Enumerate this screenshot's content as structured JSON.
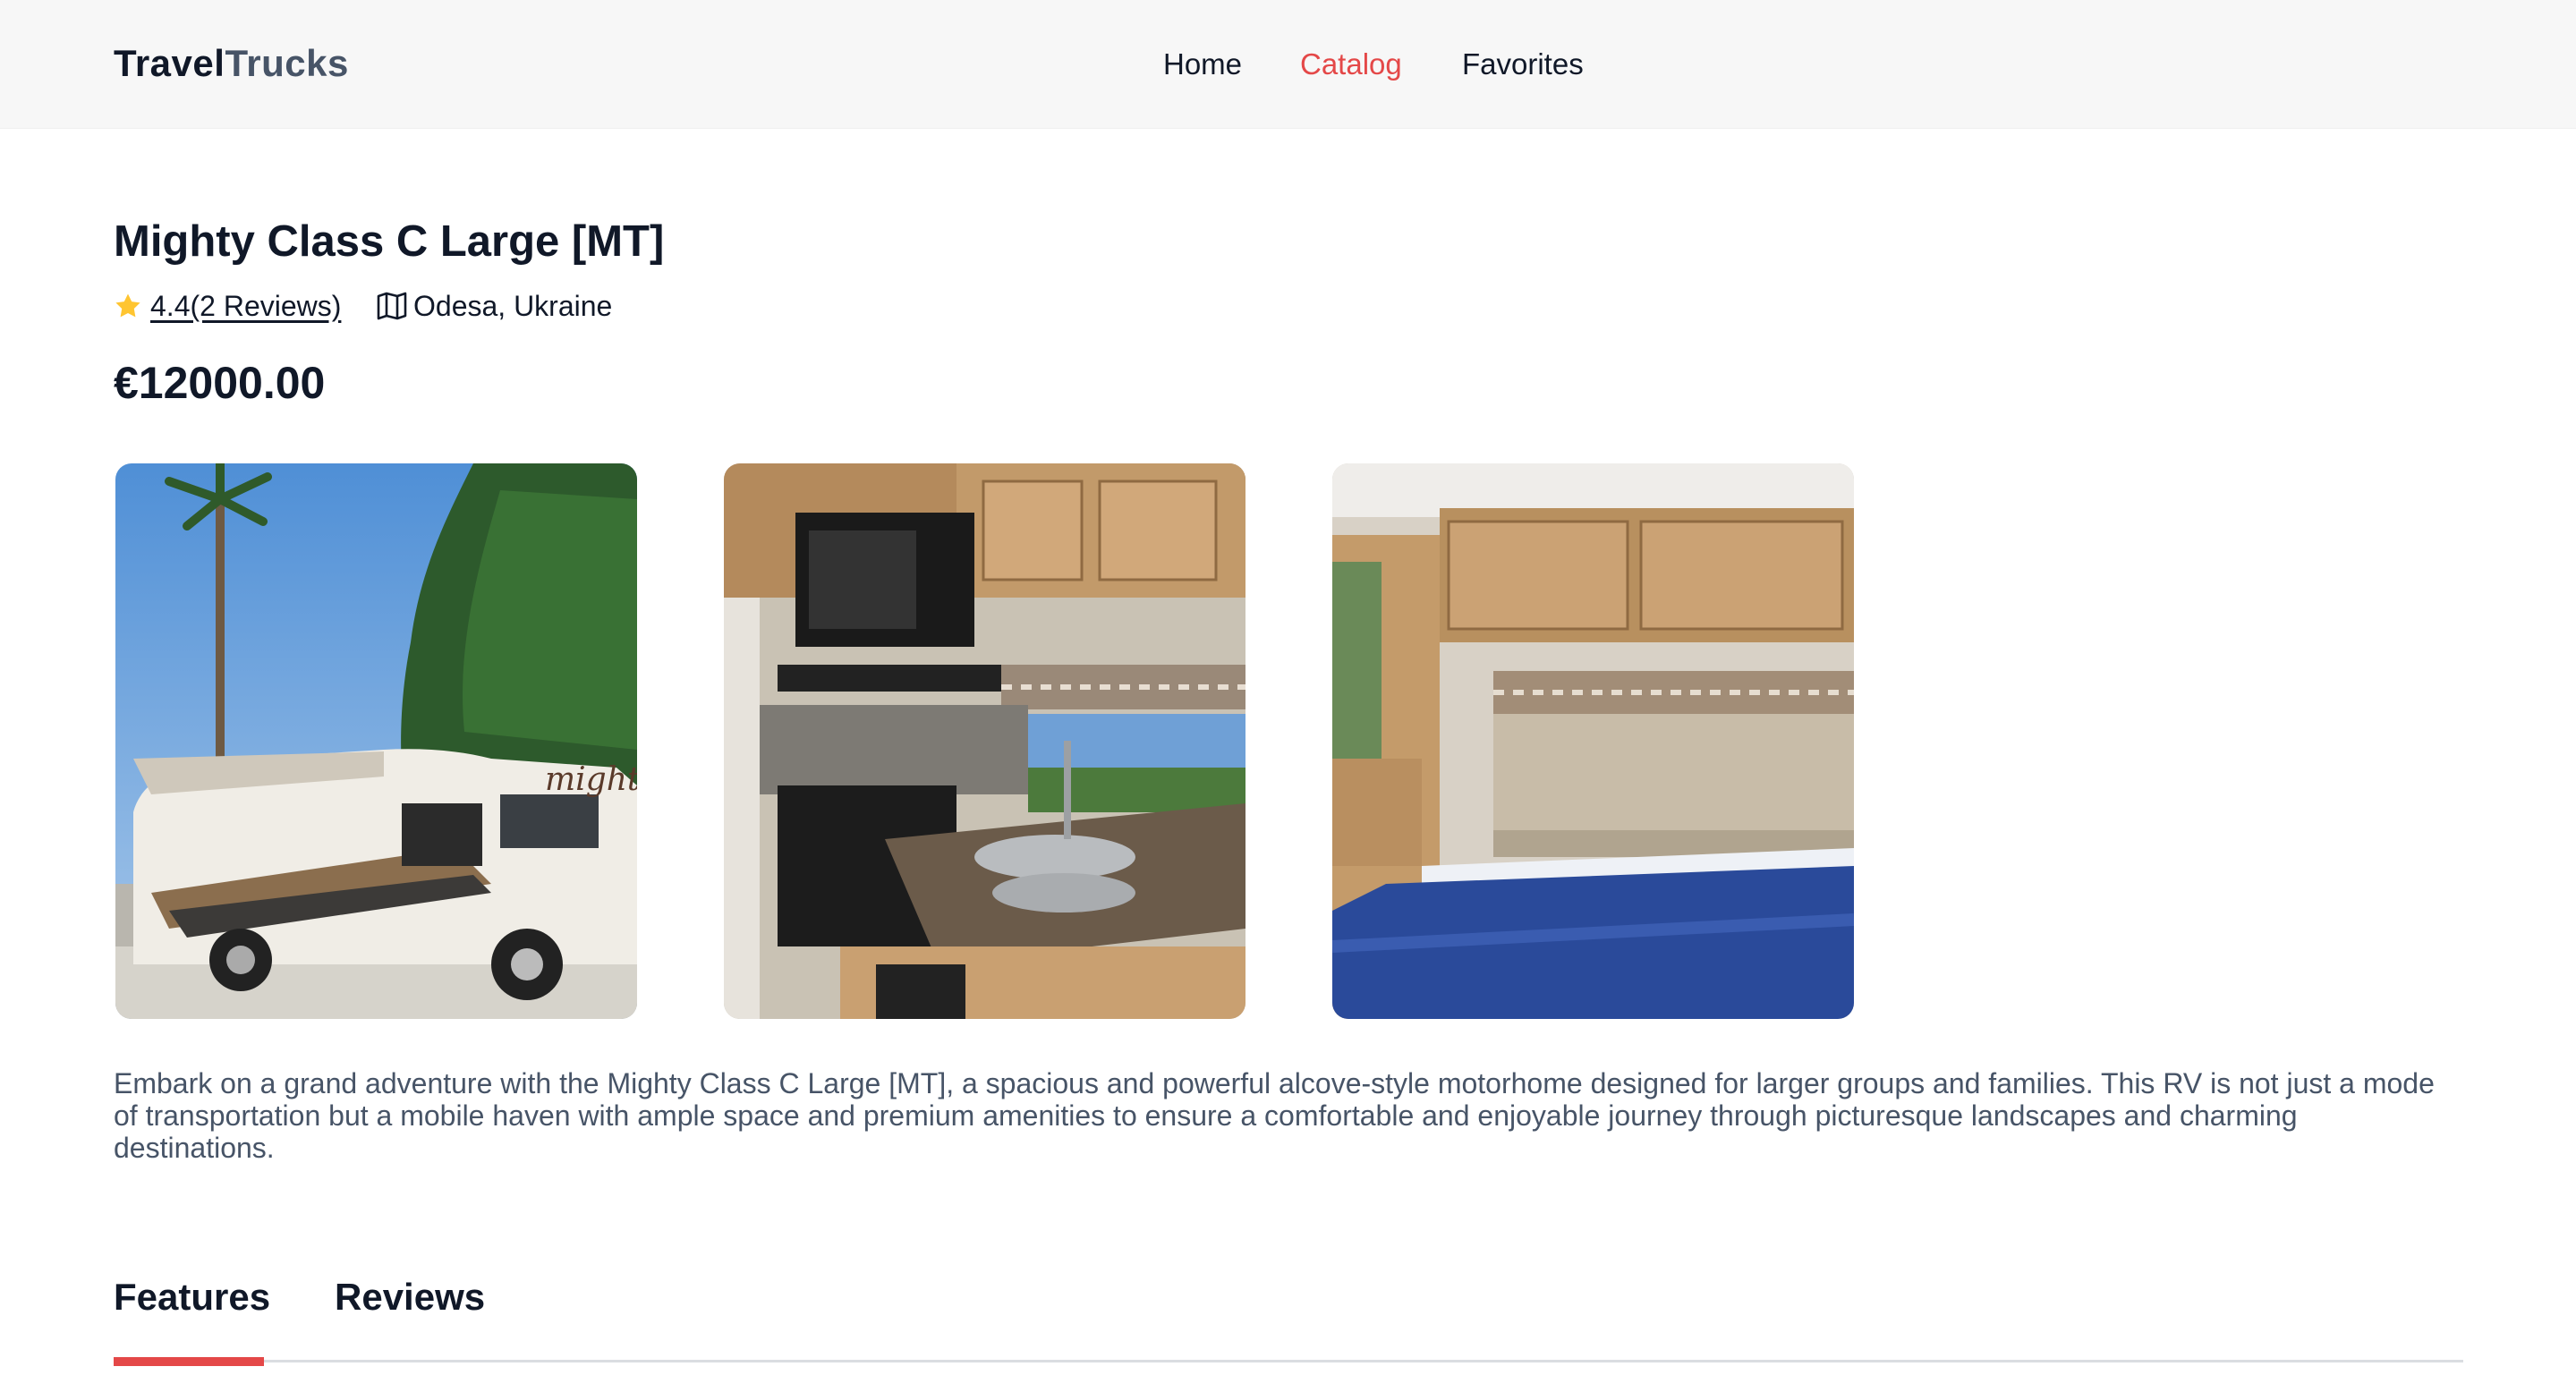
{
  "header": {
    "logo_part1": "Travel",
    "logo_part2": "Trucks",
    "nav": [
      {
        "label": "Home",
        "active": false
      },
      {
        "label": "Catalog",
        "active": true
      },
      {
        "label": "Favorites",
        "active": false
      }
    ]
  },
  "camper": {
    "name": "Mighty Class C Large [MT]",
    "rating_text": "4.4(2 Reviews)",
    "location": "Odesa, Ukraine",
    "price": "€12000.00",
    "description": "Embark on a grand adventure with the Mighty Class C Large [MT], a spacious and powerful alcove-style motorhome designed for larger groups and families. This RV is not just a mode of transportation but a mobile haven with ample space and premium amenities to ensure a comfortable and enjoyable journey through picturesque landscapes and charming destinations."
  },
  "gallery": [
    {
      "subject": "motorhome-exterior-photo"
    },
    {
      "subject": "kitchen-interior-photo"
    },
    {
      "subject": "bedroom-interior-photo"
    }
  ],
  "tabs": [
    {
      "label": "Features",
      "active": true
    },
    {
      "label": "Reviews",
      "active": false
    }
  ],
  "colors": {
    "accent": "#e44848",
    "text_primary": "#101828",
    "text_secondary": "#475467",
    "star": "#ffc531",
    "header_bg": "#f7f7f7"
  },
  "icons": {
    "rating": "star-icon",
    "location": "map-icon"
  }
}
